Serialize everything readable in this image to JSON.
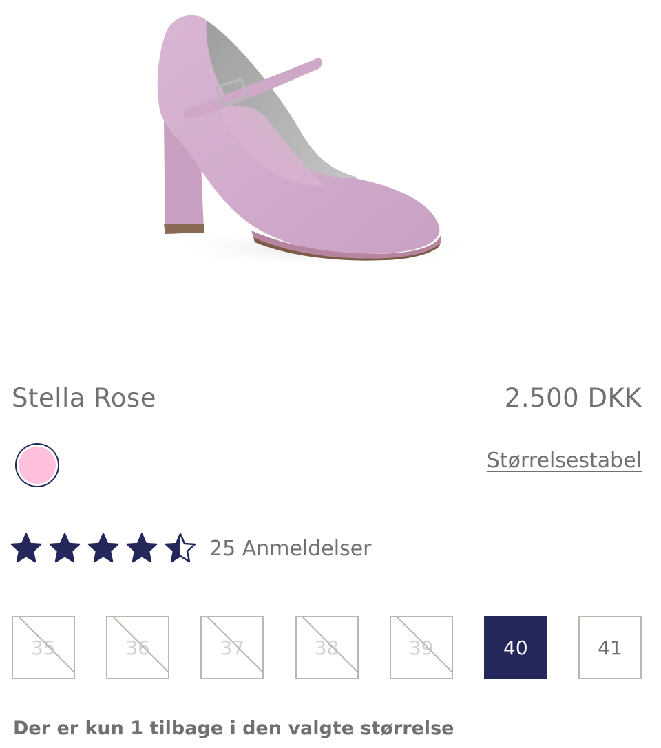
{
  "product": {
    "name": "Stella Rose",
    "price": "2.500 DKK",
    "image_alt": "pink-suede-mary-jane-pump-image"
  },
  "colors": {
    "accent": "#23275a",
    "swatch_pink": "#ffc0de",
    "text": "#707070",
    "border": "#bdb5b0"
  },
  "color_swatch": {
    "selected_color": "#ffc0de"
  },
  "size_chart": {
    "label": "Størrelsestabel"
  },
  "rating": {
    "stars_icon": "star-icon",
    "value_out_of_5": 4.5,
    "reviews_label": "25 Anmeldelser"
  },
  "sizes": [
    {
      "label": "35",
      "available": false,
      "selected": false
    },
    {
      "label": "36",
      "available": false,
      "selected": false
    },
    {
      "label": "37",
      "available": false,
      "selected": false
    },
    {
      "label": "38",
      "available": false,
      "selected": false
    },
    {
      "label": "39",
      "available": false,
      "selected": false
    },
    {
      "label": "40",
      "available": true,
      "selected": true
    },
    {
      "label": "41",
      "available": true,
      "selected": false
    }
  ],
  "stock_note": "Der er kun 1 tilbage i den valgte størrelse"
}
